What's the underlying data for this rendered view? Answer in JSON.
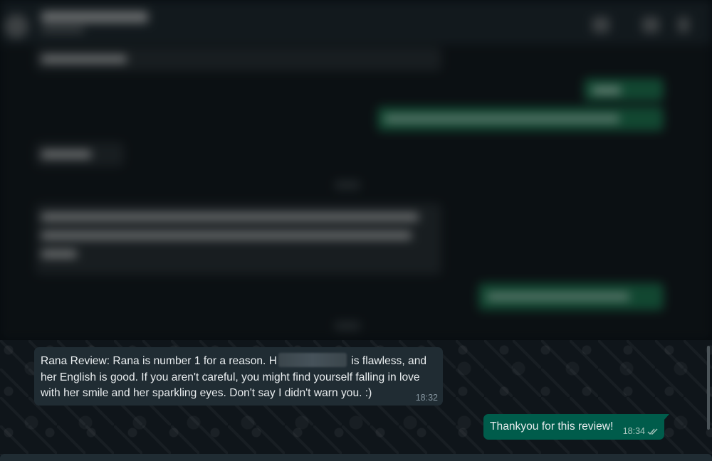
{
  "conversation": {
    "incoming_message": {
      "text_before_redaction": "Rana Review: Rana is number 1 for a reason. H",
      "text_after_redaction": " is flawless, and her English is good. If you aren't careful, you might find yourself falling in love with her smile and her sparkling eyes. Don't say I didn't warn you. :)",
      "time": "18:32"
    },
    "outgoing_message": {
      "text": "Thankyou for this review!",
      "time": "18:34",
      "status_icon": "double-check-icon"
    }
  },
  "colors": {
    "incoming_bubble": "#202c33",
    "outgoing_bubble": "#005c4b",
    "chat_background": "#0b141a"
  }
}
